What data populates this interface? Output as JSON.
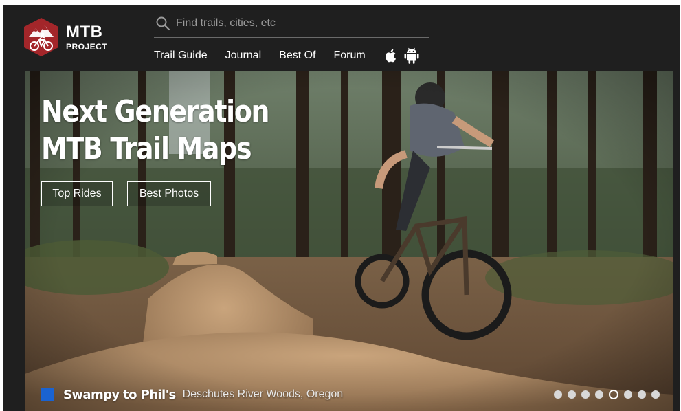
{
  "brand": {
    "line1": "MTB",
    "line2": "PROJECT",
    "color": "#a3262a"
  },
  "search": {
    "placeholder": "Find trails, cities, etc",
    "value": ""
  },
  "nav": {
    "items": [
      {
        "label": "Trail Guide"
      },
      {
        "label": "Journal"
      },
      {
        "label": "Best Of"
      },
      {
        "label": "Forum"
      }
    ],
    "apps": [
      {
        "icon": "apple-icon"
      },
      {
        "icon": "android-icon"
      }
    ]
  },
  "hero": {
    "headline_line1": "Next Generation",
    "headline_line2": "MTB Trail Maps",
    "buttons": [
      {
        "label": "Top Rides"
      },
      {
        "label": "Best Photos"
      }
    ],
    "caption": {
      "title": "Swampy to Phil's",
      "location": "Deschutes River Woods, Oregon",
      "accent": "#1a63d1"
    },
    "slides": {
      "count": 8,
      "active_index": 4
    }
  }
}
